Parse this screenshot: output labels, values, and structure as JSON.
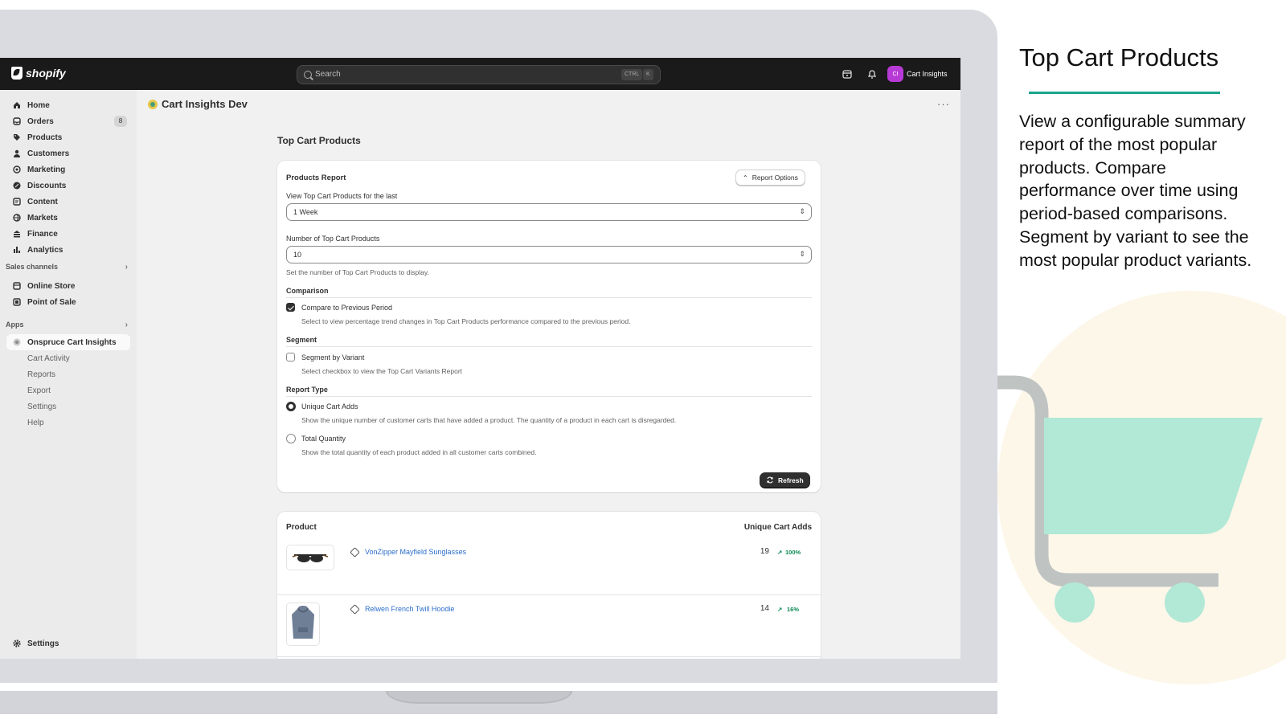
{
  "marketing": {
    "title": "Top Cart Products",
    "description": "View a configurable summary report of the most popular products. Compare performance over time using period-based comparisons. Segment by variant to see the most popular product variants.",
    "accent_color": "#19a58c",
    "cart_color": "#b2e8d6",
    "cart_frame_color": "#bfc4c3"
  },
  "topbar": {
    "logo": "shopify",
    "search_placeholder": "Search",
    "shortcut_ctrl": "CTRL",
    "shortcut_k": "K",
    "user_initials": "CI",
    "user_name": "Cart Insights",
    "icons": [
      "store-alert-icon",
      "bell-icon"
    ]
  },
  "sidebar": {
    "items": [
      {
        "label": "Home",
        "icon": "home-icon"
      },
      {
        "label": "Orders",
        "icon": "inbox-icon",
        "badge": "8"
      },
      {
        "label": "Products",
        "icon": "tag-icon"
      },
      {
        "label": "Customers",
        "icon": "person-icon"
      },
      {
        "label": "Marketing",
        "icon": "target-icon"
      },
      {
        "label": "Discounts",
        "icon": "discount-icon"
      },
      {
        "label": "Content",
        "icon": "content-icon"
      },
      {
        "label": "Markets",
        "icon": "globe-icon"
      },
      {
        "label": "Finance",
        "icon": "bank-icon"
      },
      {
        "label": "Analytics",
        "icon": "bar-chart-icon"
      }
    ],
    "sales_channels_label": "Sales channels",
    "sales_channels": [
      {
        "label": "Online Store",
        "icon": "store-icon"
      },
      {
        "label": "Point of Sale",
        "icon": "pos-icon"
      }
    ],
    "apps_label": "Apps",
    "app_name": "Onspruce Cart Insights",
    "app_subitems": [
      "Cart Activity",
      "Reports",
      "Export",
      "Settings",
      "Help"
    ],
    "settings_label": "Settings"
  },
  "main": {
    "app_title": "Cart Insights Dev",
    "page_title": "Top Cart Products",
    "report": {
      "heading": "Products Report",
      "options_button": "Report Options",
      "period_label": "View Top Cart Products for the last",
      "period_value": "1 Week",
      "count_label": "Number of Top Cart Products",
      "count_value": "10",
      "count_help": "Set the number of Top Cart Products to display.",
      "comparison_heading": "Comparison",
      "comparison_checkbox": "Compare to Previous Period",
      "comparison_checked": true,
      "comparison_help": "Select to view percentage trend changes in Top Cart Products performance compared to the previous period.",
      "segment_heading": "Segment",
      "segment_checkbox": "Segment by Variant",
      "segment_checked": false,
      "segment_help": "Select checkbox to view the Top Cart Variants Report",
      "type_heading": "Report Type",
      "type_option1": "Unique Cart Adds",
      "type_option1_help": "Show the unique number of customer carts that have added a product. The quantity of a product in each cart is disregarded.",
      "type_option2": "Total Quantity",
      "type_option2_help": "Show the total quantity of each product added in all customer carts combined.",
      "selected_type": "Unique Cart Adds",
      "refresh_button": "Refresh"
    },
    "table": {
      "col_product": "Product",
      "col_metric": "Unique Cart Adds",
      "rows": [
        {
          "name": "VonZipper Mayfield Sunglasses",
          "count": "19",
          "trend": "100%"
        },
        {
          "name": "Relwen French Twill Hoodie",
          "count": "14",
          "trend": "16%"
        }
      ]
    }
  }
}
